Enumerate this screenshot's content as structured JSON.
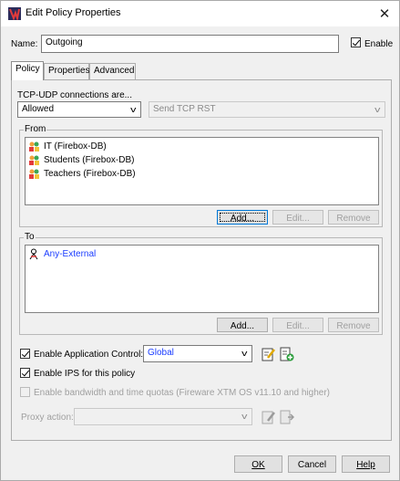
{
  "window": {
    "title": "Edit Policy Properties",
    "close_glyph": "✕"
  },
  "name_field": {
    "label": "Name:",
    "value": "Outgoing"
  },
  "enable": {
    "label": "Enable",
    "checked": true
  },
  "tabs": [
    {
      "label": "Policy",
      "active": true
    },
    {
      "label": "Properties",
      "active": false
    },
    {
      "label": "Advanced",
      "active": false
    }
  ],
  "connections": {
    "label": "TCP-UDP connections are...",
    "action": "Allowed",
    "secondary_action": "Send TCP RST"
  },
  "from": {
    "label": "From",
    "items": [
      {
        "label": "IT (Firebox-DB)",
        "icon": "user-group-icon"
      },
      {
        "label": "Students (Firebox-DB)",
        "icon": "user-group-icon"
      },
      {
        "label": "Teachers (Firebox-DB)",
        "icon": "user-group-icon"
      }
    ],
    "buttons": {
      "add": "Add...",
      "edit": "Edit...",
      "remove": "Remove"
    }
  },
  "to": {
    "label": "To",
    "items": [
      {
        "label": "Any-External",
        "icon": "external-alias-icon"
      }
    ],
    "buttons": {
      "add": "Add...",
      "edit": "Edit...",
      "remove": "Remove"
    }
  },
  "app_control": {
    "label": "Enable Application Control:",
    "checked": true,
    "value": "Global"
  },
  "ips": {
    "label": "Enable IPS for this policy",
    "checked": true
  },
  "bandwidth": {
    "label": "Enable bandwidth and time quotas (Fireware XTM OS v11.10 and higher)",
    "checked": false,
    "enabled": false
  },
  "proxy": {
    "label": "Proxy action:",
    "value": ""
  },
  "footer": {
    "ok": "OK",
    "cancel": "Cancel",
    "help": "Help"
  },
  "colors": {
    "accent": "#0078d7",
    "alias_text": "#1a3cff"
  }
}
